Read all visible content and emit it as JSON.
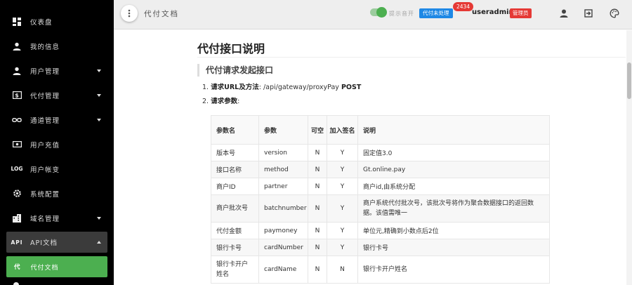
{
  "sidebar": {
    "items": [
      {
        "icon": "dashboard-icon",
        "label": "仪表盘",
        "caret": false
      },
      {
        "icon": "person-icon",
        "label": "我的信息",
        "caret": false
      },
      {
        "icon": "person-icon",
        "label": "用户管理",
        "caret": true
      },
      {
        "icon": "dollar-icon",
        "label": "代付管理",
        "caret": true
      },
      {
        "icon": "infinity-icon",
        "label": "通道管理",
        "caret": true
      },
      {
        "icon": "cash-icon",
        "label": "用户充值",
        "caret": false
      },
      {
        "icon": "log-icon",
        "icon_text": "LOG",
        "label": "用户帐变",
        "caret": false
      },
      {
        "icon": "gear-icon",
        "label": "系统配置",
        "caret": false
      },
      {
        "icon": "domain-icon",
        "label": "域名管理",
        "caret": true
      }
    ],
    "open_group": {
      "icon_text": "API",
      "label": "API文档"
    },
    "active_sub": {
      "icon_text": "代",
      "label": "代付文档"
    }
  },
  "header": {
    "title": "代付文档",
    "toggle_label": "提示音开",
    "pending_label": "代付未处理",
    "pending_count": "2434",
    "username": "useradmin",
    "role": "管理员"
  },
  "doc": {
    "title": "代付接口说明",
    "section": "代付请求发起接口",
    "step1_num": "1.",
    "step1_label": "请求URL及方法",
    "step1_colon": ":",
    "step1_url": "/api/gateway/proxyPay",
    "step1_method": "POST",
    "step2_num": "2.",
    "step2_label": "请求参数",
    "step2_colon": ":"
  },
  "table": {
    "headers": {
      "name": "参数名",
      "param": "参数",
      "optional": "可空",
      "signed": "加入签名",
      "desc": "说明"
    },
    "rows": [
      {
        "name": "版本号",
        "param": "version",
        "optional": "N",
        "signed": "Y",
        "desc": "固定值3.0"
      },
      {
        "name": "接口名称",
        "param": "method",
        "optional": "N",
        "signed": "Y",
        "desc": "Gt.online.pay"
      },
      {
        "name": "商户ID",
        "param": "partner",
        "optional": "N",
        "signed": "Y",
        "desc": "商户id,由系统分配"
      },
      {
        "name": "商户批次号",
        "param": "batchnumber",
        "optional": "N",
        "signed": "Y",
        "desc": "商户系统代付批次号，该批次号将作为聚合数据接口的返回数据。该值需唯一"
      },
      {
        "name": "代付金额",
        "param": "paymoney",
        "optional": "N",
        "signed": "Y",
        "desc": "单位元,精确到小数点后2位"
      },
      {
        "name": "银行卡号",
        "param": "cardNumber",
        "optional": "N",
        "signed": "Y",
        "desc": "银行卡号"
      },
      {
        "name": "银行卡开户姓名",
        "param": "cardName",
        "optional": "N",
        "signed": "N",
        "desc": "银行卡开户姓名"
      }
    ]
  },
  "colors": {
    "sidebar_bg": "#000000",
    "active_green": "#4caf50",
    "pending_blue": "#1e88e5",
    "badge_red": "#e53935"
  }
}
